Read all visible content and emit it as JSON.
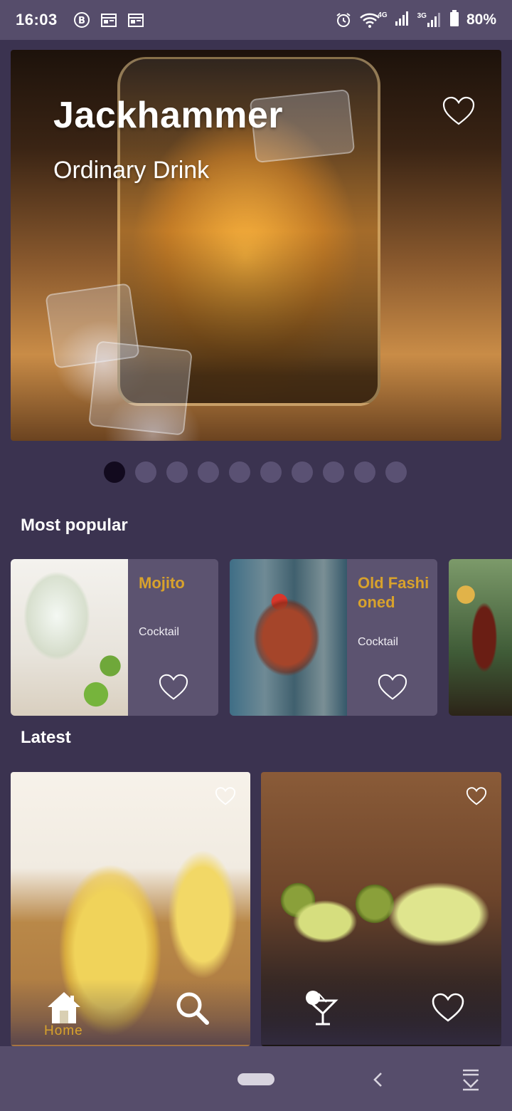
{
  "status_bar": {
    "time": "16:03",
    "left_icons": [
      "b-badge-icon",
      "calendar-icon",
      "calendar-icon"
    ],
    "right_icons": [
      "alarm-icon",
      "wifi-icon",
      "signal-4g-icon",
      "signal-3g-icon",
      "battery-icon"
    ],
    "network_4g": "4G",
    "network_3g": "3G",
    "battery": "80%"
  },
  "hero": {
    "title": "Jackhammer",
    "subtitle": "Ordinary Drink",
    "favorite_icon": "heart-outline-icon",
    "pager": {
      "total": 10,
      "active_index": 0
    }
  },
  "most_popular": {
    "title": "Most popular",
    "items": [
      {
        "name": "Mojito",
        "category": "Cocktail"
      },
      {
        "name": "Old Fashioned",
        "category": "Cocktail"
      }
    ]
  },
  "latest": {
    "title": "Latest"
  },
  "bottom_nav": {
    "items": [
      {
        "label": "Home",
        "icon": "home-icon",
        "active": true
      },
      {
        "icon": "search-icon"
      },
      {
        "icon": "cocktail-icon"
      },
      {
        "icon": "heart-outline-icon"
      }
    ]
  },
  "system_nav": {
    "icons": [
      "home-pill-icon",
      "back-icon",
      "download-menu-icon"
    ]
  },
  "colors": {
    "background": "#3b3350",
    "card": "#5c5370",
    "accent": "#d8a22c",
    "status_bar": "#564d6b",
    "dot_active": "#120a1e",
    "dot_inactive": "#5a5173"
  }
}
